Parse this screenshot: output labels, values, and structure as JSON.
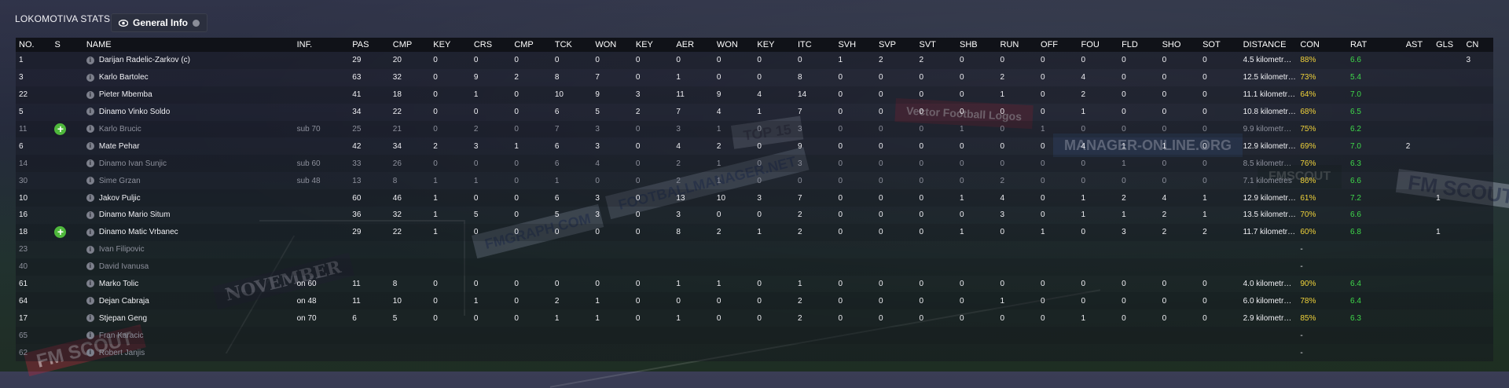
{
  "header": {
    "club_title": "LOKOMOTIVA STATS",
    "tab_label": "General Info"
  },
  "watermarks": [
    "FMGRAPH.COM",
    "FOOTBALLMANAGER.NET",
    "MANAGER-ONLINE.ORG",
    "FM SCOUT",
    "Vector Football Logos",
    "NOVEMBER",
    "FM SCOUT",
    "TOP 15",
    "FMSCOUT"
  ],
  "colors": {
    "con_color": "#f0d23a",
    "rat_color": "#3fd84a",
    "sub_icon": "#4fb83c"
  },
  "columns": [
    "NO.",
    "S",
    "NAME",
    "INF.",
    "PAS",
    "CMP",
    "KEY",
    "CRS",
    "CMP",
    "TCK",
    "WON",
    "KEY",
    "AER",
    "WON",
    "KEY",
    "ITC",
    "SVH",
    "SVP",
    "SVT",
    "SHB",
    "RUN",
    "OFF",
    "FOU",
    "FLD",
    "SHO",
    "SOT",
    "DISTANCE",
    "CON",
    "RAT",
    "AST",
    "GLS",
    "CN"
  ],
  "rows": [
    {
      "cells": [
        "1",
        "",
        "Darijan Radelic-Zarkov (c)",
        "",
        "29",
        "20",
        "0",
        "0",
        "0",
        "0",
        "0",
        "0",
        "0",
        "0",
        "0",
        "0",
        "1",
        "2",
        "2",
        "0",
        "0",
        "0",
        "0",
        "0",
        "0",
        "0",
        "4.5 kilometr…",
        "88%",
        "6.6",
        "",
        "",
        "3"
      ]
    },
    {
      "cells": [
        "3",
        "",
        "Karlo Bartolec",
        "",
        "63",
        "32",
        "0",
        "9",
        "2",
        "8",
        "7",
        "0",
        "1",
        "0",
        "0",
        "8",
        "0",
        "0",
        "0",
        "0",
        "2",
        "0",
        "4",
        "0",
        "0",
        "0",
        "12.5 kilometr…",
        "73%",
        "5.4",
        "",
        "",
        ""
      ]
    },
    {
      "cells": [
        "22",
        "",
        "Pieter Mbemba",
        "",
        "41",
        "18",
        "0",
        "1",
        "0",
        "10",
        "9",
        "3",
        "11",
        "9",
        "4",
        "14",
        "0",
        "0",
        "0",
        "0",
        "1",
        "0",
        "2",
        "0",
        "0",
        "0",
        "11.1 kilometr…",
        "64%",
        "7.0",
        "",
        "",
        ""
      ]
    },
    {
      "cells": [
        "5",
        "",
        "Dinamo Vinko Soldo",
        "",
        "34",
        "22",
        "0",
        "0",
        "0",
        "6",
        "5",
        "2",
        "7",
        "4",
        "1",
        "7",
        "0",
        "0",
        "0",
        "0",
        "0",
        "0",
        "1",
        "0",
        "0",
        "0",
        "10.8 kilometr…",
        "68%",
        "6.5",
        "",
        "",
        ""
      ]
    },
    {
      "dim": true,
      "sub": true,
      "cells": [
        "11",
        "",
        "Karlo Brucic",
        "sub 70",
        "25",
        "21",
        "0",
        "2",
        "0",
        "7",
        "3",
        "0",
        "3",
        "1",
        "0",
        "3",
        "0",
        "0",
        "0",
        "1",
        "0",
        "1",
        "0",
        "0",
        "0",
        "0",
        "9.9 kilometr…",
        "75%",
        "6.2",
        "",
        "",
        ""
      ]
    },
    {
      "cells": [
        "6",
        "",
        "Mate Pehar",
        "",
        "42",
        "34",
        "2",
        "3",
        "1",
        "6",
        "3",
        "0",
        "4",
        "2",
        "0",
        "9",
        "0",
        "0",
        "0",
        "0",
        "0",
        "0",
        "4",
        "1",
        "1",
        "0",
        "12.9 kilometr…",
        "69%",
        "7.0",
        "2",
        "",
        ""
      ]
    },
    {
      "dim": true,
      "cells": [
        "14",
        "",
        "Dinamo Ivan Sunjic",
        "sub 60",
        "33",
        "26",
        "0",
        "0",
        "0",
        "6",
        "4",
        "0",
        "2",
        "1",
        "0",
        "3",
        "0",
        "0",
        "0",
        "0",
        "0",
        "0",
        "0",
        "1",
        "0",
        "0",
        "8.5 kilometr…",
        "76%",
        "6.3",
        "",
        "",
        ""
      ]
    },
    {
      "dim": true,
      "cells": [
        "30",
        "",
        "Sime Grzan",
        "sub 48",
        "13",
        "8",
        "1",
        "1",
        "0",
        "1",
        "0",
        "0",
        "2",
        "1",
        "0",
        "0",
        "0",
        "0",
        "0",
        "0",
        "2",
        "0",
        "0",
        "0",
        "0",
        "0",
        "7.1 kilometres",
        "86%",
        "6.6",
        "",
        "",
        ""
      ]
    },
    {
      "cells": [
        "10",
        "",
        "Jakov Puljic",
        "",
        "60",
        "46",
        "1",
        "0",
        "0",
        "6",
        "3",
        "0",
        "13",
        "10",
        "3",
        "7",
        "0",
        "0",
        "0",
        "1",
        "4",
        "0",
        "1",
        "2",
        "4",
        "1",
        "12.9 kilometr…",
        "61%",
        "7.2",
        "",
        "1",
        ""
      ]
    },
    {
      "cells": [
        "16",
        "",
        "Dinamo Mario Situm",
        "",
        "36",
        "32",
        "1",
        "5",
        "0",
        "5",
        "3",
        "0",
        "3",
        "0",
        "0",
        "2",
        "0",
        "0",
        "0",
        "0",
        "3",
        "0",
        "1",
        "1",
        "2",
        "1",
        "13.5 kilometr…",
        "70%",
        "6.6",
        "",
        "",
        ""
      ]
    },
    {
      "sub": true,
      "cells": [
        "18",
        "",
        "Dinamo Matic Vrbanec",
        "",
        "29",
        "22",
        "1",
        "0",
        "0",
        "0",
        "0",
        "0",
        "8",
        "2",
        "1",
        "2",
        "0",
        "0",
        "0",
        "1",
        "0",
        "1",
        "0",
        "3",
        "2",
        "2",
        "11.7 kilometr…",
        "60%",
        "6.8",
        "",
        "1",
        ""
      ]
    },
    {
      "dim": true,
      "cells": [
        "23",
        "",
        "Ivan Filipovic",
        "",
        "",
        "",
        "",
        "",
        "",
        "",
        "",
        "",
        "",
        "",
        "",
        "",
        "",
        "",
        "",
        "",
        "",
        "",
        "",
        "",
        "",
        "",
        "",
        "-",
        "",
        "",
        "",
        ""
      ]
    },
    {
      "dim": true,
      "cells": [
        "40",
        "",
        "David Ivanusa",
        "",
        "",
        "",
        "",
        "",
        "",
        "",
        "",
        "",
        "",
        "",
        "",
        "",
        "",
        "",
        "",
        "",
        "",
        "",
        "",
        "",
        "",
        "",
        "",
        "-",
        "",
        "",
        "",
        ""
      ]
    },
    {
      "cells": [
        "61",
        "",
        "Marko Tolic",
        "on 60",
        "11",
        "8",
        "0",
        "0",
        "0",
        "0",
        "0",
        "0",
        "1",
        "1",
        "0",
        "1",
        "0",
        "0",
        "0",
        "0",
        "0",
        "0",
        "0",
        "0",
        "0",
        "0",
        "4.0 kilometr…",
        "90%",
        "6.4",
        "",
        "",
        ""
      ]
    },
    {
      "cells": [
        "64",
        "",
        "Dejan Cabraja",
        "on 48",
        "11",
        "10",
        "0",
        "1",
        "0",
        "2",
        "1",
        "0",
        "0",
        "0",
        "0",
        "2",
        "0",
        "0",
        "0",
        "0",
        "1",
        "0",
        "0",
        "0",
        "0",
        "0",
        "6.0 kilometr…",
        "78%",
        "6.4",
        "",
        "",
        ""
      ]
    },
    {
      "cells": [
        "17",
        "",
        "Stjepan Geng",
        "on 70",
        "6",
        "5",
        "0",
        "0",
        "0",
        "1",
        "1",
        "0",
        "1",
        "0",
        "0",
        "2",
        "0",
        "0",
        "0",
        "0",
        "0",
        "0",
        "1",
        "0",
        "0",
        "0",
        "2.9 kilometr…",
        "85%",
        "6.3",
        "",
        "",
        ""
      ]
    },
    {
      "dim": true,
      "cells": [
        "65",
        "",
        "Fran Karacic",
        "",
        "",
        "",
        "",
        "",
        "",
        "",
        "",
        "",
        "",
        "",
        "",
        "",
        "",
        "",
        "",
        "",
        "",
        "",
        "",
        "",
        "",
        "",
        "",
        "-",
        "",
        "",
        "",
        ""
      ]
    },
    {
      "dim": true,
      "cells": [
        "62",
        "",
        "Robert Janjis",
        "",
        "",
        "",
        "",
        "",
        "",
        "",
        "",
        "",
        "",
        "",
        "",
        "",
        "",
        "",
        "",
        "",
        "",
        "",
        "",
        "",
        "",
        "",
        "",
        "-",
        "",
        "",
        "",
        ""
      ]
    }
  ]
}
